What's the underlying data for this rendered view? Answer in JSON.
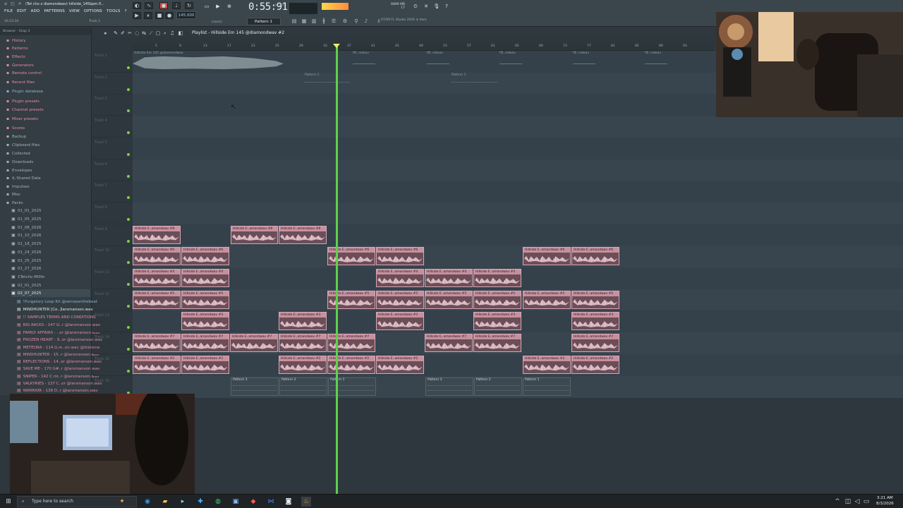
{
  "window": {
    "title": "(Tet cho x diamondwav) hillside_145bpm.fl...",
    "menu": [
      "FILE",
      "EDIT",
      "ADD",
      "PATTERNS",
      "VIEW",
      "OPTIONS",
      "TOOLS",
      "?"
    ],
    "clock_hint": "16:15:10",
    "tools_hint": "Track 1",
    "none_label": "(none)"
  },
  "transport": {
    "bpm": "145.000",
    "time": "0:55:91",
    "time_sub": "M:S:CS",
    "pattern": "Pattern 1",
    "cpu_mb": "6899 MB",
    "cpu_num": "17",
    "hint": "07/09 FL Studio 2026 is here"
  },
  "browser": {
    "header": "Browser - Snap 4",
    "items": [
      {
        "label": "History",
        "color": "pink",
        "icon": "folder"
      },
      {
        "label": "Patterns",
        "color": "pink",
        "icon": "folder"
      },
      {
        "label": "Effects",
        "color": "pink",
        "icon": "folder"
      },
      {
        "label": "Generators",
        "color": "pink",
        "icon": "folder"
      },
      {
        "label": "Remote control",
        "color": "pink",
        "icon": "folder"
      },
      {
        "label": "Recent files",
        "color": "pink",
        "icon": "folder"
      },
      {
        "label": "Plugin database",
        "color": "blue",
        "icon": "folder"
      },
      {
        "label": "Plugin presets",
        "color": "pink",
        "icon": "folder"
      },
      {
        "label": "Channel presets",
        "color": "pink",
        "icon": "folder"
      },
      {
        "label": "Mixer presets",
        "color": "pink",
        "icon": "folder"
      },
      {
        "label": "Scores",
        "color": "pink",
        "icon": "folder"
      },
      {
        "label": "Backup",
        "color": "grey",
        "icon": "folder"
      },
      {
        "label": "Clipboard files",
        "color": "grey",
        "icon": "folder"
      },
      {
        "label": "Collected",
        "color": "grey",
        "icon": "folder"
      },
      {
        "label": "Downloads",
        "color": "grey",
        "icon": "folder"
      },
      {
        "label": "Envelopes",
        "color": "grey",
        "icon": "folder"
      },
      {
        "label": "IL Shared Data",
        "color": "grey",
        "icon": "folder"
      },
      {
        "label": "Impulses",
        "color": "grey",
        "icon": "folder"
      },
      {
        "label": "Misc",
        "color": "grey",
        "icon": "folder"
      },
      {
        "label": "Packs",
        "color": "grey",
        "icon": "folder"
      },
      {
        "label": "01_01_2025",
        "color": "grey",
        "icon": "pack"
      },
      {
        "label": "01_05_2025",
        "color": "grey",
        "icon": "pack"
      },
      {
        "label": "01_08_2026",
        "color": "grey",
        "icon": "pack"
      },
      {
        "label": "01_10_2026",
        "color": "grey",
        "icon": "pack"
      },
      {
        "label": "01_18_2025",
        "color": "grey",
        "icon": "pack"
      },
      {
        "label": "01_24_2026",
        "color": "grey",
        "icon": "pack"
      },
      {
        "label": "01_25_2025",
        "color": "grey",
        "icon": "pack"
      },
      {
        "label": "01_27_2026",
        "color": "grey",
        "icon": "pack"
      },
      {
        "label": "1Tetcho MIDIs",
        "color": "grey",
        "icon": "pack"
      },
      {
        "label": "02_01_2025",
        "color": "grey",
        "icon": "pack"
      },
      {
        "label": "02_07_2025",
        "color": "white",
        "icon": "pack"
      },
      {
        "label": "!Purgatory Loop Kit @serrasonthebeat",
        "color": "blue",
        "icon": "file"
      },
      {
        "label": "MINDHUNTER [Co..]larsmanson.wav",
        "color": "white",
        "icon": "file"
      },
      {
        "label": "!! SAMPLES TERMS AND CONDITIONS",
        "color": "pink",
        "icon": "file"
      },
      {
        "label": "BIG RACKS - 147 G..r @larsmanson.wav",
        "color": "pink",
        "icon": "file"
      },
      {
        "label": "FAMILY AFFAIRS - ..or @larsmanson.wav",
        "color": "pink",
        "icon": "file"
      },
      {
        "label": "FROZEN HEART - 9..or @larsmanson.wav",
        "color": "pink",
        "icon": "file"
      },
      {
        "label": "METEORA - 114 G.m..on.wav @lilsklone",
        "color": "pink",
        "icon": "file"
      },
      {
        "label": "MINDHUNTER - 15..r @larsmanson.wav",
        "color": "pink",
        "icon": "file"
      },
      {
        "label": "REFLECTIONS - 14..or @larsmanson.wav",
        "color": "pink",
        "icon": "file"
      },
      {
        "label": "SAVE ME - 170 G#..r @larsmanson.wav",
        "color": "pink",
        "icon": "file"
      },
      {
        "label": "SNIPER - 142 C mi..r @larsmanson.wav",
        "color": "pink",
        "icon": "file"
      },
      {
        "label": "VALKYRIES - 137 C..or @larsmanson.wav",
        "color": "pink",
        "icon": "file"
      },
      {
        "label": "WARRIOR - 138 D..r @larsmanson.wav",
        "color": "pink",
        "icon": "file"
      }
    ]
  },
  "playlist": {
    "title": "Playlist - Hillside Em 145 @diamondwav #2",
    "bars": [
      "5",
      "9",
      "13",
      "17",
      "21",
      "25",
      "29",
      "33",
      "37",
      "41",
      "45",
      "49",
      "53",
      "57",
      "61",
      "65",
      "69",
      "73",
      "77",
      "81",
      "85",
      "89",
      "93"
    ],
    "top_clip_name": "Hillside Em 145 @diamondwav",
    "fill_clip_names": [
      "fill..ndwav",
      "fill..ndwav",
      "fill..ndwav",
      "fill..ndwav",
      "fill..ndwav"
    ],
    "pattern1_top": [
      "Pattern 1",
      "Pattern 1"
    ],
    "tracks": [
      "Track 1",
      "Track 2",
      "Track 3",
      "Track 4",
      "Track 5",
      "Track 6",
      "Track 7",
      "Track 8",
      "Track 9",
      "Track 10",
      "Track 11",
      "Track 12",
      "Track 13",
      "Track 14",
      "Track 15",
      "Track 16"
    ],
    "stems": [
      "Hillside E..amondwav #8",
      "Hillside E..amondwav #6",
      "Hillside E..amondwav #4",
      "Hillside E..amondwav #5",
      "Hillside E..amondwav #3",
      "Hillside E..amondwav #7",
      "Hillside E..amondwav #2"
    ],
    "patterns_row": [
      "Pattern 3",
      "Pattern 2",
      "Pattern 1",
      "Pattern 3",
      "Pattern 2",
      "Pattern 1"
    ]
  },
  "taskbar": {
    "search_placeholder": "Type here to search",
    "time": "3:21 AM",
    "date": "8/3/2026"
  },
  "colors": {
    "playhead": "#5fd14a",
    "clip_header": "#c7909e",
    "track_dot": "#7bd33f",
    "lane": "#34414a"
  }
}
